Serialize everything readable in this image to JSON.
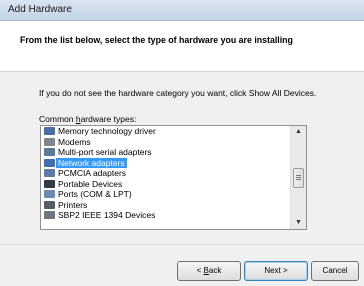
{
  "window": {
    "title": "Add Hardware"
  },
  "header": {
    "text": "From the list below, select the type of hardware you are installing"
  },
  "content": {
    "hint": "If you do not see the hardware category you want, click Show All Devices.",
    "list_label_pre": "Common ",
    "list_label_accel": "h",
    "list_label_post": "ardware types:"
  },
  "hardware_types": [
    {
      "label": "Memory technology driver",
      "icon": "memory-icon",
      "color": "#4a6fa5"
    },
    {
      "label": "Modems",
      "icon": "modem-icon",
      "color": "#7d8790"
    },
    {
      "label": "Multi-port serial adapters",
      "icon": "serial-port-icon",
      "color": "#5a7a9a"
    },
    {
      "label": "Network adapters",
      "icon": "network-adapter-icon",
      "color": "#3f6fb0",
      "selected": true
    },
    {
      "label": "PCMCIA adapters",
      "icon": "pcmcia-icon",
      "color": "#5e7aa8"
    },
    {
      "label": "Portable Devices",
      "icon": "portable-device-icon",
      "color": "#333a44"
    },
    {
      "label": "Ports (COM & LPT)",
      "icon": "port-icon",
      "color": "#6b8bb0"
    },
    {
      "label": "Printers",
      "icon": "printer-icon",
      "color": "#555d66"
    },
    {
      "label": "SBP2 IEEE 1394 Devices",
      "icon": "ieee1394-icon",
      "color": "#6d7580"
    }
  ],
  "scrollbar": {
    "up_glyph": "▲",
    "down_glyph": "▼"
  },
  "buttons": {
    "back_pre": "< ",
    "back_accel": "B",
    "back_post": "ack",
    "next": "Next >",
    "cancel": "Cancel"
  },
  "colors": {
    "selection": "#3399ff",
    "titlebar": "#c9d8ea"
  }
}
